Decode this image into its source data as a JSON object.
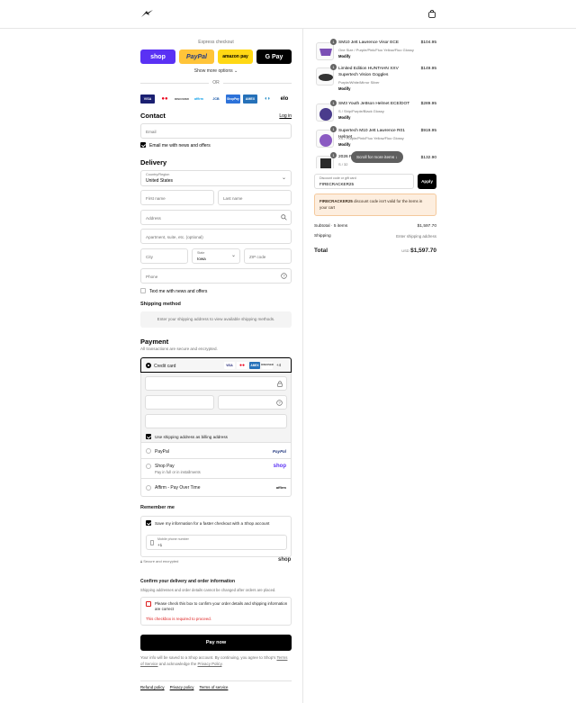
{
  "header": {
    "logo_icon": "alpinestars-logo-icon",
    "cart_icon": "shopping-bag-icon"
  },
  "express": {
    "label": "Express checkout",
    "buttons": [
      {
        "label": "shop",
        "bg": "#5a31f4",
        "fg": "#ffffff"
      },
      {
        "label": "PayPal",
        "bg": "#ffc439",
        "fg": "#253b80"
      },
      {
        "label": "amazon pay",
        "bg": "#ffd814",
        "fg": "#000000"
      },
      {
        "label": "G Pay",
        "bg": "#000000",
        "fg": "#ffffff"
      }
    ],
    "show_more": "Show more options",
    "or": "OR"
  },
  "payment_logos": [
    {
      "label": "VISA",
      "bg": "#1a1f71",
      "fg": "#ffffff"
    },
    {
      "label": "●●",
      "bg": "#ffffff",
      "fg": "#eb001b"
    },
    {
      "label": "DISCOVER",
      "bg": "#ffffff",
      "fg": "#333333"
    },
    {
      "label": "affirm",
      "bg": "#ffffff",
      "fg": "#0fa0ea"
    },
    {
      "label": "JCB",
      "bg": "#ffffff",
      "fg": "#0b4ea2"
    },
    {
      "label": "ShopPay",
      "bg": "#2d72d9",
      "fg": "#ffffff"
    },
    {
      "label": "AMEX",
      "bg": "#2671b9",
      "fg": "#ffffff"
    },
    {
      "label": "◖◗",
      "bg": "#ffffff",
      "fg": "#0079be"
    },
    {
      "label": "elo",
      "bg": "#ffffff",
      "fg": "#000000"
    }
  ],
  "contact": {
    "title": "Contact",
    "login": "Log in",
    "email_placeholder": "Email",
    "email_news": "Email me with news and offers"
  },
  "delivery": {
    "title": "Delivery",
    "country_label": "Country/Region",
    "country_value": "United States",
    "first_name": "First name",
    "last_name": "Last name",
    "address": "Address",
    "apartment": "Apartment, suite, etc. (optional)",
    "city": "City",
    "state_label": "State",
    "state_value": "Iowa",
    "zip": "ZIP code",
    "phone": "Phone",
    "text_news": "Text me with news and offers"
  },
  "shipping": {
    "title": "Shipping method",
    "note": "Enter your shipping address to view available shipping methods."
  },
  "payment": {
    "title": "Payment",
    "subtitle": "All transactions are secure and encrypted.",
    "credit_card": "Credit card",
    "card_logos": [
      {
        "label": "VISA",
        "bg": "#ffffff",
        "fg": "#1a1f71"
      },
      {
        "label": "●●",
        "bg": "#ffffff",
        "fg": "#eb001b"
      },
      {
        "label": "AMEX",
        "bg": "#2671b9",
        "fg": "#ffffff"
      },
      {
        "label": "DISCOVER",
        "bg": "#ffffff",
        "fg": "#333333"
      }
    ],
    "more_cards": "+4",
    "billing_same": "Use shipping address as billing address",
    "options": [
      {
        "label": "PayPal",
        "sub": "",
        "logo": "PayPal",
        "logo_color": "#253b80"
      },
      {
        "label": "Shop Pay",
        "sub": "Pay in full or in installments",
        "logo": "shop",
        "logo_color": "#5a31f4"
      },
      {
        "label": "Affirm - Pay Over Time",
        "sub": "",
        "logo": "affirm",
        "logo_color": "#000000"
      }
    ]
  },
  "remember": {
    "title": "Remember me",
    "save_info": "Save my information for a faster checkout with a Shop account",
    "mobile_label": "Mobile phone number",
    "mobile_value": "+1",
    "secure": "Secure and encrypted",
    "shop_logo": "shop"
  },
  "confirm": {
    "title": "Confirm your delivery and order information",
    "subtitle": "Shipping addresses and order details cannot be changed after orders are placed.",
    "checkbox": "Please check this box to confirm your order details and shipping information are correct",
    "error": "This checkbox is required to proceed."
  },
  "pay_now": "Pay now",
  "legal": {
    "prefix": "Your info will be saved to a Shop account. By continuing, you agree to Shop's",
    "terms": "Terms of Service",
    "mid": "and acknowledge the",
    "privacy": "Privacy Policy",
    "suffix": "."
  },
  "footer_links": [
    "Refund policy",
    "Privacy policy",
    "Terms of service"
  ],
  "order": {
    "items": [
      {
        "qty": "1",
        "name": "SM10 Jett Lawrence Visor ECE",
        "variant": "One Size / Purple/Pink/Fluo Yellow/Fluo Glossy",
        "modify": "Modify",
        "price": "$104.95",
        "color": "#7b4fb5"
      },
      {
        "qty": "1",
        "name": "Limited Edition HUNTAHN XXV Supertech Vision Goggles",
        "variant": "Purple/White/Mirror Silver",
        "modify": "Modify",
        "price": "$149.95",
        "color": "#333333"
      },
      {
        "qty": "1",
        "name": "SM3 Youth Jettson Helmet ECE/DOT",
        "variant": "S / Ship/Purple/Black Glossy",
        "modify": "Modify",
        "price": "$289.95",
        "color": "#4a3c8c"
      },
      {
        "qty": "1",
        "name": "Supertech M10 Jett Lawrence R01 Helmet",
        "variant": "XS / Purple/Pink/Fluo Yellow/Fluo Glossy",
        "modify": "Modify",
        "price": "$919.95",
        "color": "#8a5ac2"
      },
      {
        "qty": "1",
        "name": "2026 R",
        "variant": "S / 32",
        "modify": "",
        "price": "$132.90",
        "color": "#2a2a2a"
      }
    ],
    "scroll_hint": "Scroll for more items",
    "discount_label": "Discount code or gift card",
    "discount_value": "FIRECRACKER25",
    "apply": "Apply",
    "error_code": "FIRECRACKER25",
    "error_text": "discount code isn't valid for the items in your cart",
    "subtotal_label": "Subtotal · 5 items",
    "subtotal_value": "$1,597.70",
    "shipping_label": "Shipping",
    "shipping_value": "Enter shipping address",
    "total_label": "Total",
    "currency": "USD",
    "total_value": "$1,597.70"
  }
}
